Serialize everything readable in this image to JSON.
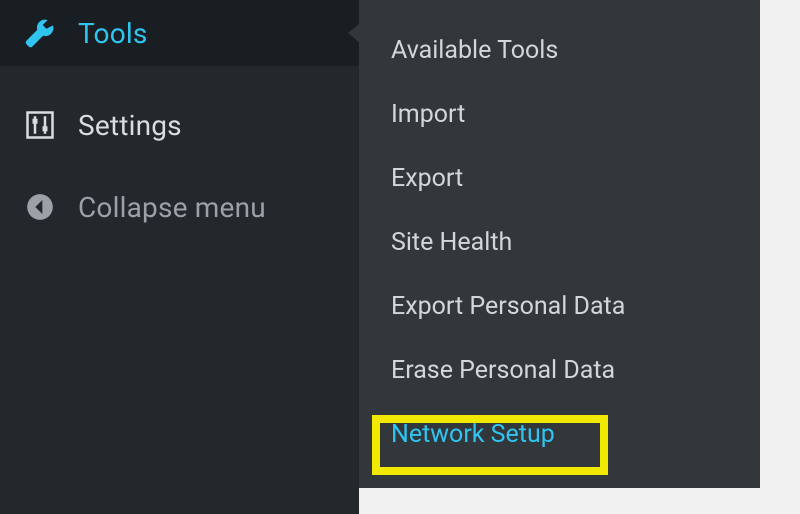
{
  "colors": {
    "accent": "#30c5f0",
    "highlight": "#f2e900",
    "sidebar_bg": "#23282d",
    "submenu_bg": "#32373c"
  },
  "sidebar": {
    "items": [
      {
        "id": "tools",
        "label": "Tools",
        "icon": "wrench-icon",
        "active": true
      },
      {
        "id": "settings",
        "label": "Settings",
        "icon": "sliders-icon",
        "active": false
      },
      {
        "id": "collapse",
        "label": "Collapse menu",
        "icon": "collapse-left-icon",
        "active": false
      }
    ]
  },
  "submenu": {
    "parent": "tools",
    "items": [
      {
        "label": "Available Tools"
      },
      {
        "label": "Import"
      },
      {
        "label": "Export"
      },
      {
        "label": "Site Health"
      },
      {
        "label": "Export Personal Data"
      },
      {
        "label": "Erase Personal Data"
      },
      {
        "label": "Network Setup",
        "highlighted": true
      }
    ]
  }
}
